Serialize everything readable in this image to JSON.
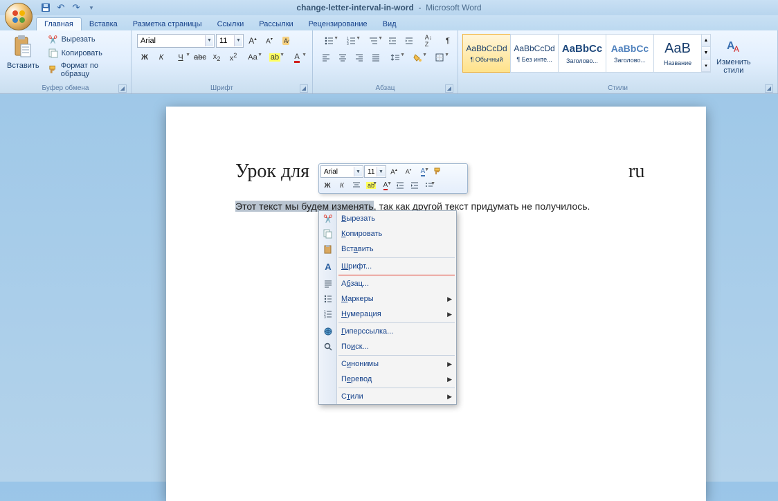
{
  "title": {
    "doc": "change-letter-interval-in-word",
    "app": "Microsoft Word"
  },
  "tabs": [
    "Главная",
    "Вставка",
    "Разметка страницы",
    "Ссылки",
    "Рассылки",
    "Рецензирование",
    "Вид"
  ],
  "clipboard": {
    "label": "Буфер обмена",
    "paste": "Вставить",
    "cut": "Вырезать",
    "copy": "Копировать",
    "format": "Формат по образцу"
  },
  "font": {
    "label": "Шрифт",
    "name": "Arial",
    "size": "11"
  },
  "paragraph": {
    "label": "Абзац"
  },
  "styles": {
    "label": "Стили",
    "items": [
      {
        "preview": "AaBbCcDd",
        "name": "¶ Обычный",
        "selected": true
      },
      {
        "preview": "AaBbCcDd",
        "name": "¶ Без инте..."
      },
      {
        "preview": "AaBbCc",
        "name": "Заголово...",
        "color": "#1f497d",
        "big": true
      },
      {
        "preview": "AaBbCc",
        "name": "Заголово...",
        "color": "#4f81bd",
        "big": true
      },
      {
        "preview": "AaB",
        "name": "Название",
        "big2": true
      }
    ],
    "change": "Изменить\nстили"
  },
  "doc": {
    "h1": "Урок для",
    "ru": "ru",
    "p_sel": "Этот текст мы будем изменять",
    "p_rest": ", так как другой текст придумать не получилось."
  },
  "mini": {
    "font": "Arial",
    "size": "11"
  },
  "ctx": {
    "cut": "Вырезать",
    "copy": "Копировать",
    "paste": "Вставить",
    "font": "Шрифт...",
    "para": "Абзац...",
    "bullets": "Маркеры",
    "numbering": "Нумерация",
    "link": "Гиперссылка...",
    "find": "Поиск...",
    "synonyms": "Синонимы",
    "translate": "Перевод",
    "styles": "Стили"
  }
}
